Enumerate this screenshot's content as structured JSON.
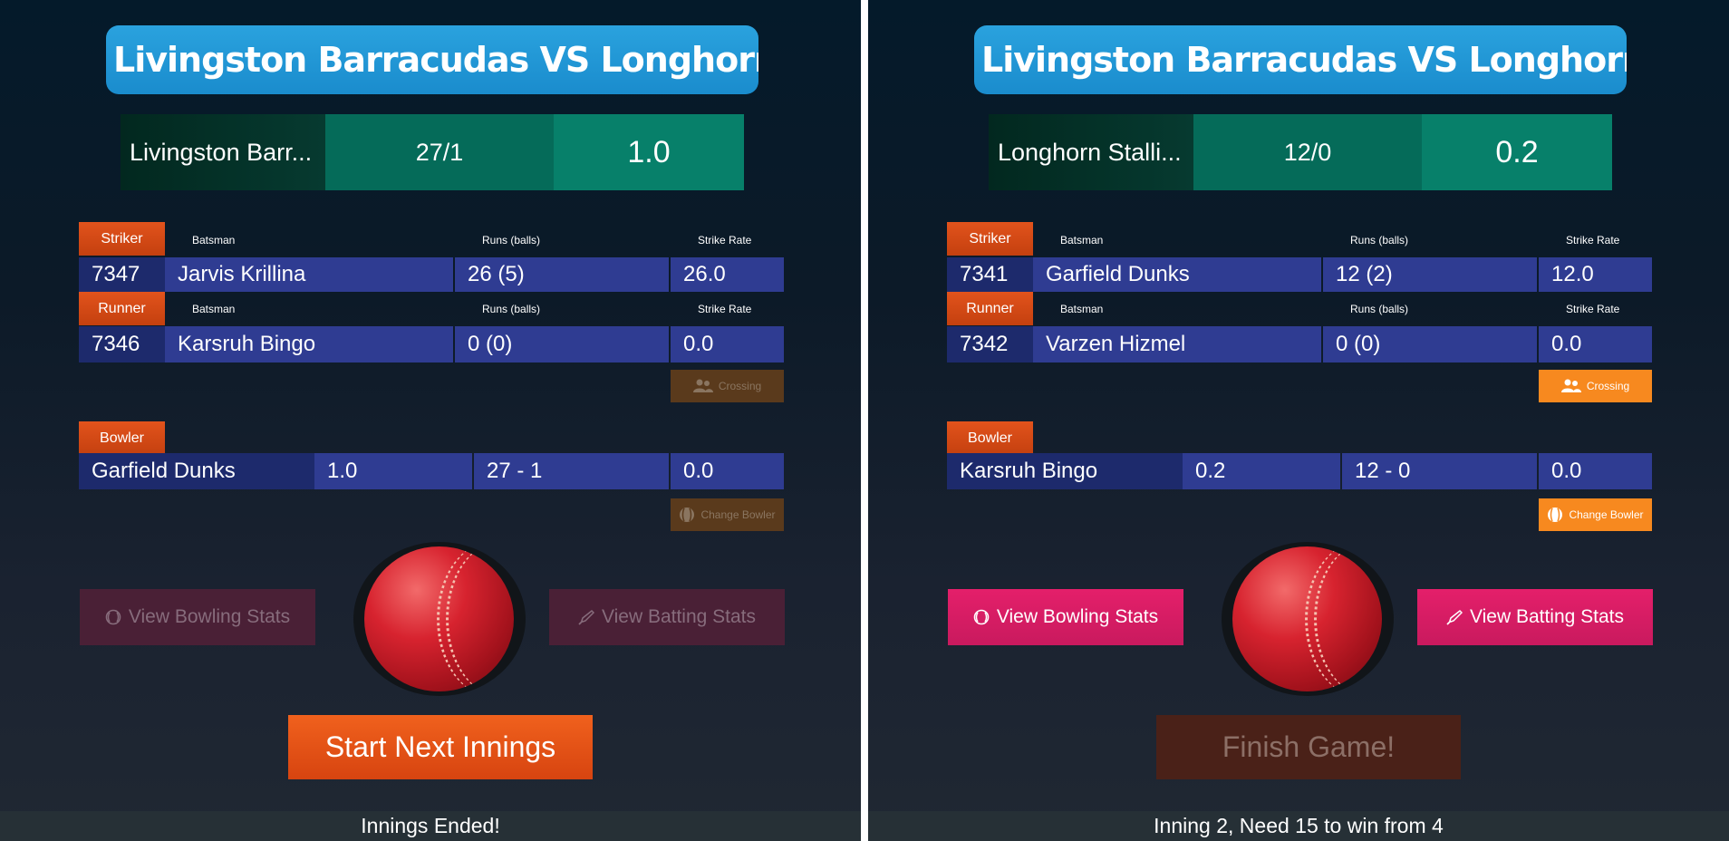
{
  "panels": [
    {
      "title": "Livingston Barracudas VS Longhorn S...",
      "score": {
        "team": "Livingston Barr...",
        "runs": "27/1",
        "overs": "1.0"
      },
      "striker": {
        "tag": "Striker",
        "hdr_batsman": "Batsman",
        "hdr_runs": "Runs (balls)",
        "hdr_sr": "Strike Rate",
        "id": "7347",
        "name": "Jarvis Krillina",
        "runs": "26 (5)",
        "sr": "26.0"
      },
      "runner": {
        "tag": "Runner",
        "hdr_batsman": "Batsman",
        "hdr_runs": "Runs (balls)",
        "hdr_sr": "Strike Rate",
        "id": "7346",
        "name": "Karsruh Bingo",
        "runs": "0 (0)",
        "sr": "0.0"
      },
      "crossing_label": "Crossing",
      "bowler": {
        "tag": "Bowler",
        "name": "Garfield Dunks",
        "overs": "1.0",
        "figures": "27 - 1",
        "econ": "0.0"
      },
      "change_bowler_label": "Change Bowler",
      "bowling_stats_label": "View Bowling Stats",
      "batting_stats_label": "View Batting Stats",
      "main_button_label": "Start Next Innings",
      "status": "Innings Ended!"
    },
    {
      "title": "Livingston Barracudas VS Longhorn S...",
      "score": {
        "team": "Longhorn Stalli...",
        "runs": "12/0",
        "overs": "0.2"
      },
      "striker": {
        "tag": "Striker",
        "hdr_batsman": "Batsman",
        "hdr_runs": "Runs (balls)",
        "hdr_sr": "Strike Rate",
        "id": "7341",
        "name": "Garfield Dunks",
        "runs": "12 (2)",
        "sr": "12.0"
      },
      "runner": {
        "tag": "Runner",
        "hdr_batsman": "Batsman",
        "hdr_runs": "Runs (balls)",
        "hdr_sr": "Strike Rate",
        "id": "7342",
        "name": "Varzen Hizmel",
        "runs": "0 (0)",
        "sr": "0.0"
      },
      "crossing_label": "Crossing",
      "bowler": {
        "tag": "Bowler",
        "name": "Karsruh Bingo",
        "overs": "0.2",
        "figures": "12 - 0",
        "econ": "0.0"
      },
      "change_bowler_label": "Change Bowler",
      "bowling_stats_label": "View Bowling Stats",
      "batting_stats_label": "View Batting Stats",
      "main_button_label": "Finish Game!",
      "status": "Inning 2, Need 15 to win from 4"
    }
  ],
  "icons": {
    "crossing": "users-icon",
    "change_bowler": "ball-icon",
    "bowling_stats": "cricket-ball-icon",
    "batting_stats": "cricket-bat-icon"
  },
  "colors": {
    "title_bg": "#1a8ccd",
    "tag_orange": "#e2531c",
    "row_blue": "#2f3c92",
    "accent_orange": "#f7891f",
    "accent_pink": "#e41f6a",
    "score_green": "#07806a"
  }
}
